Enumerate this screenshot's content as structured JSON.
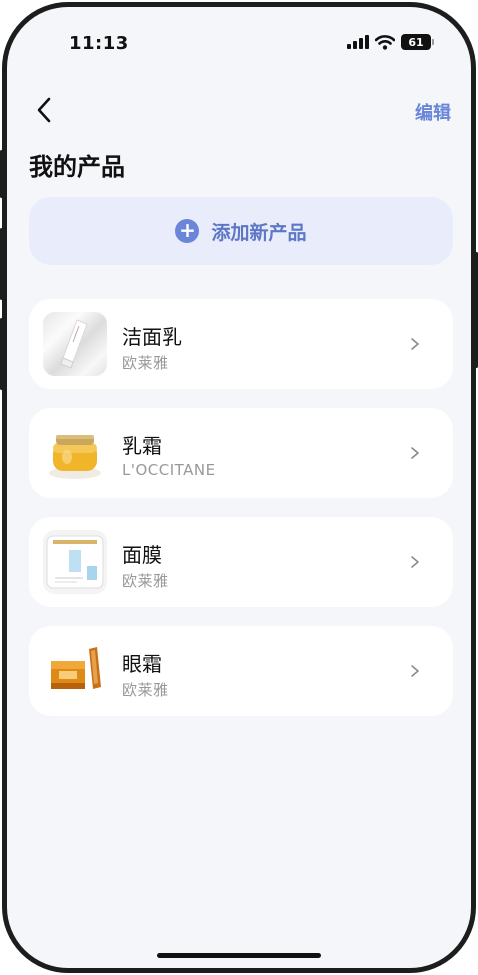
{
  "status_bar": {
    "time": "11:13",
    "battery": "61"
  },
  "nav": {
    "edit_label": "编辑"
  },
  "page": {
    "title": "我的产品"
  },
  "add_button": {
    "label": "添加新产品"
  },
  "products": [
    {
      "name": "洁面乳",
      "brand": "欧莱雅"
    },
    {
      "name": "乳霜",
      "brand": "L'OCCITANE"
    },
    {
      "name": "面膜",
      "brand": "欧莱雅"
    },
    {
      "name": "眼霜",
      "brand": "欧莱雅"
    }
  ],
  "colors": {
    "accent": "#6a86d8",
    "add_bg": "#e9ecfb",
    "background": "#f5f6fa"
  }
}
